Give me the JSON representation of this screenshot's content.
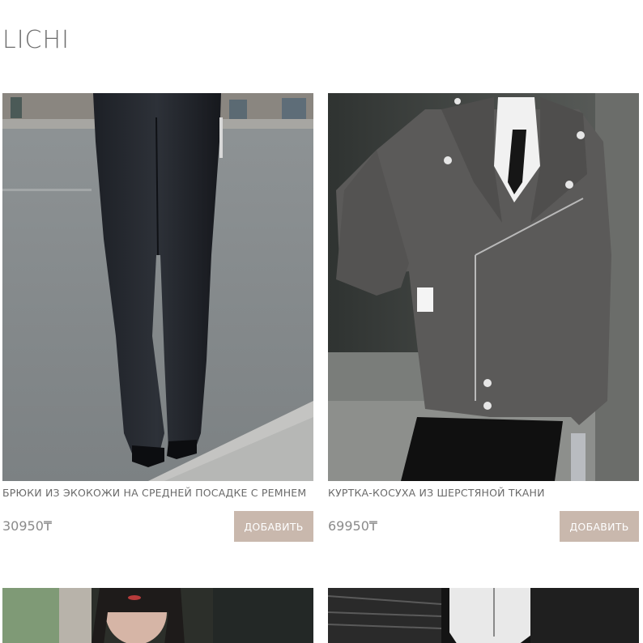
{
  "brand": "LICHI",
  "products": [
    {
      "name": "БРЮКИ ИЗ ЭКОКОЖИ НА СРЕДНЕЙ ПОСАДКЕ С РЕМНЕМ",
      "price": "30950₸",
      "button": "ДОБАВИТЬ"
    },
    {
      "name": "КУРТКА-КОСУХА ИЗ ШЕРСТЯНОЙ ТКАНИ",
      "price": "69950₸",
      "button": "ДОБАВИТЬ"
    }
  ],
  "colors": {
    "button_bg": "#c9b8ad",
    "button_text": "#ffffff",
    "brand_text": "#6e6e6e"
  }
}
